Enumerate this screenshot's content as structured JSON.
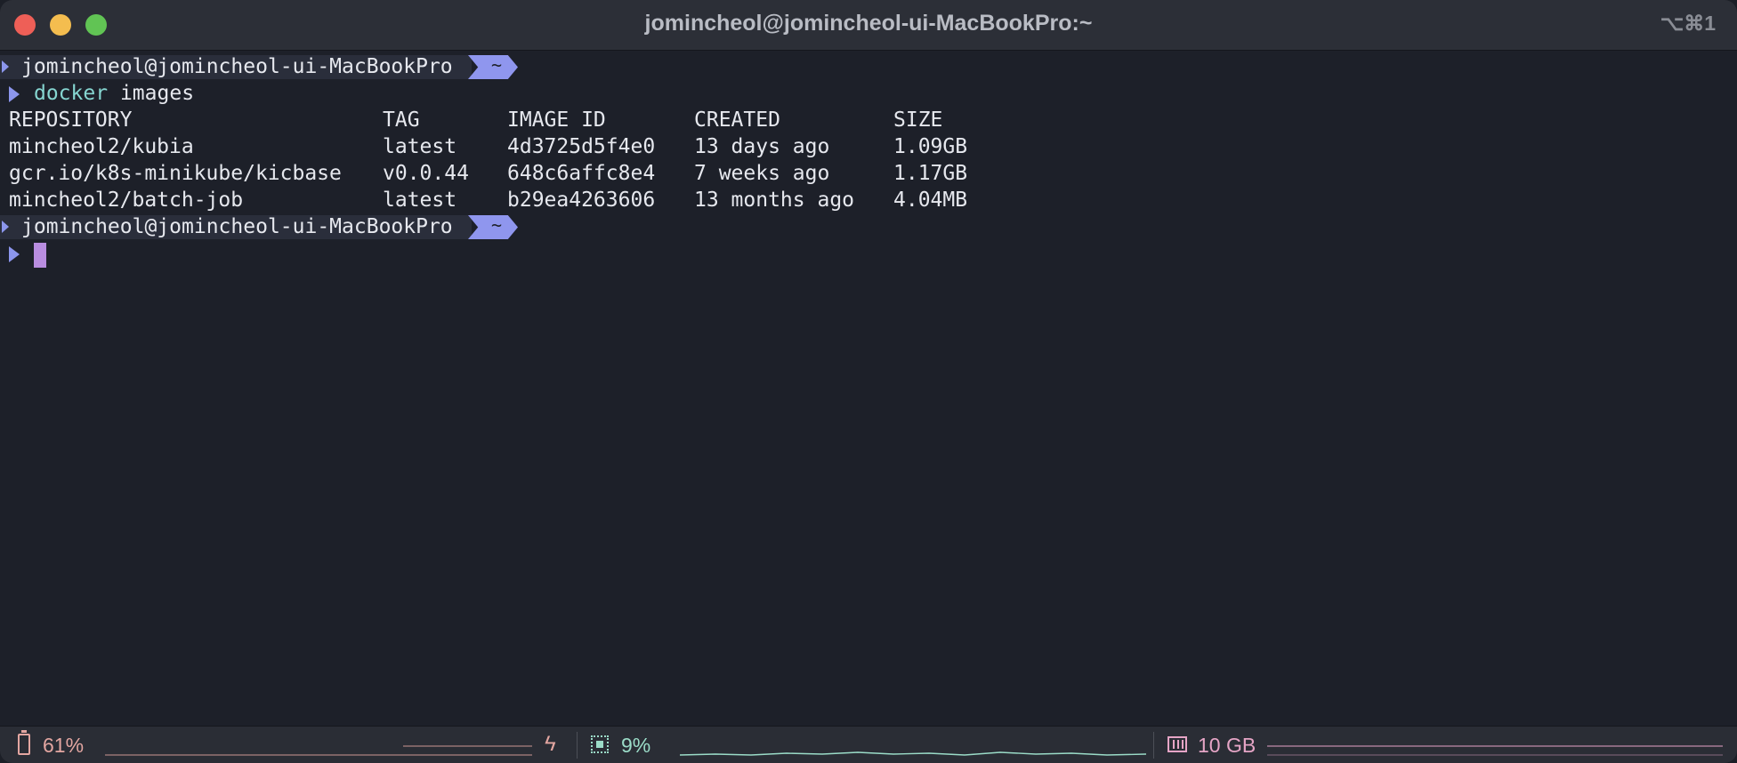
{
  "window": {
    "title": "jomincheol@jomincheol-ui-MacBookPro:~",
    "shortcut": "⌥⌘1"
  },
  "prompt": {
    "host": "jomincheol@jomincheol-ui-MacBookPro",
    "dir": "~"
  },
  "command": {
    "name": "docker",
    "args": "images"
  },
  "table": {
    "headers": [
      "REPOSITORY",
      "TAG",
      "IMAGE ID",
      "CREATED",
      "SIZE"
    ],
    "rows": [
      [
        "mincheol2/kubia",
        "latest",
        "4d3725d5f4e0",
        "13 days ago",
        "1.09GB"
      ],
      [
        "gcr.io/k8s-minikube/kicbase",
        "v0.0.44",
        "648c6affc8e4",
        "7 weeks ago",
        "1.17GB"
      ],
      [
        "mincheol2/batch-job",
        "latest",
        "b29ea4263606",
        "13 months ago",
        "4.04MB"
      ]
    ]
  },
  "status": {
    "battery": "61%",
    "cpu": "9%",
    "memory": "10 GB",
    "colors": {
      "battery": "#e3a6a1",
      "cpu": "#9bdcc8",
      "memory": "#e6a5c6"
    }
  },
  "colors": {
    "accent": "#8f96ee",
    "cursor": "#b98de0",
    "command": "#86d6d1"
  }
}
